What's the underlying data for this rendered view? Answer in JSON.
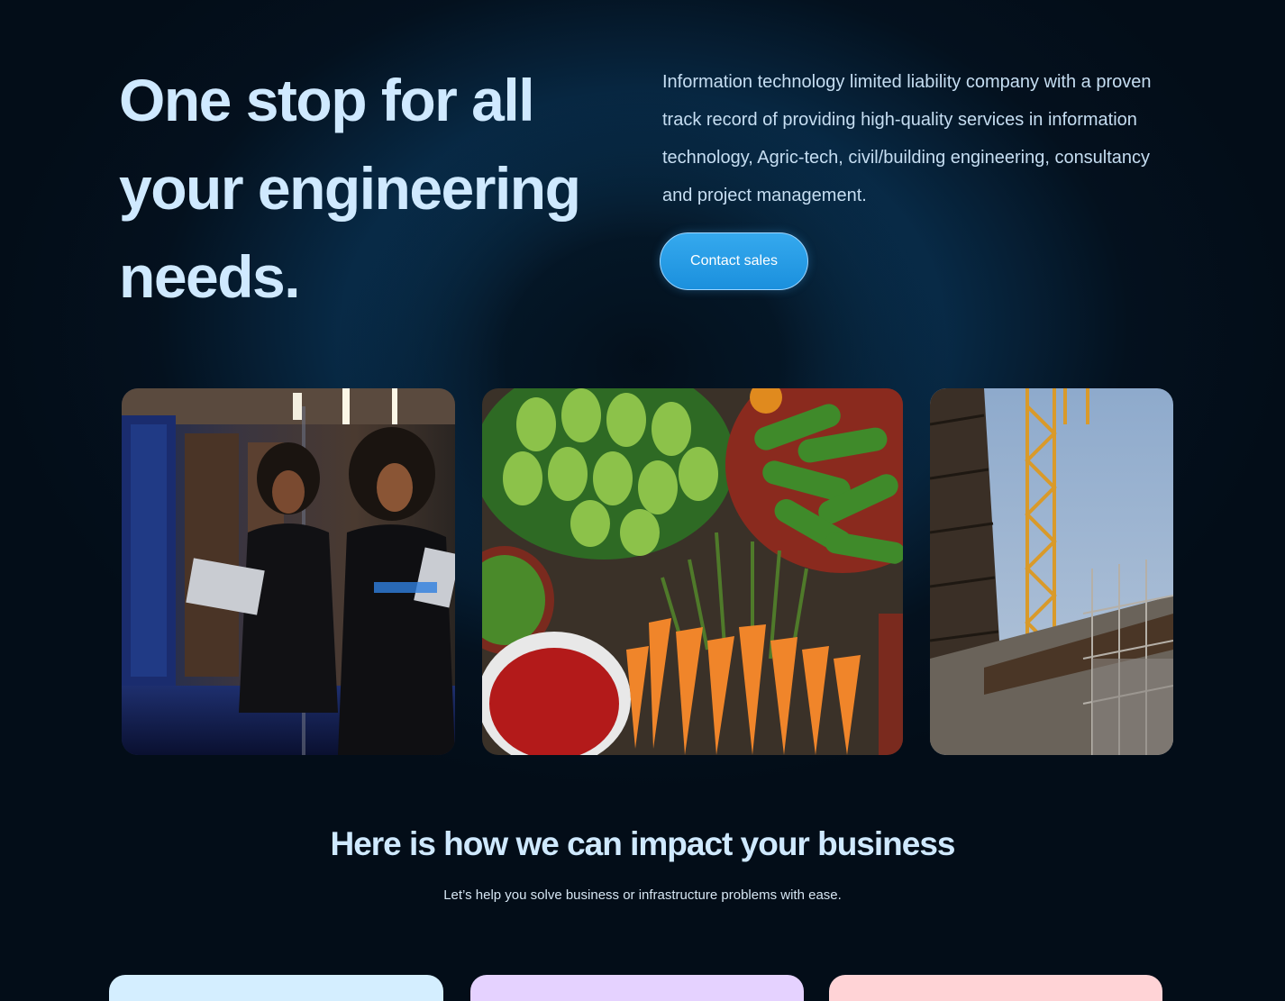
{
  "hero": {
    "title": "One stop for all your engineering needs.",
    "description": "Information technology limited liability company with a proven track record of providing high-quality services in information technology, Agric-tech, civil/building engineering, consultancy and project management.",
    "cta_label": "Contact sales"
  },
  "colors": {
    "background": "#030d18",
    "heading": "#cfe9ff",
    "accent": "#2a9fe8",
    "card_1": "#d4eeff",
    "card_2": "#e5d2ff",
    "card_3": "#ffd3d6"
  },
  "gallery": [
    {
      "subject": "woman with laptop in server room"
    },
    {
      "subject": "market vegetables: bitter gourds, cucumbers, carrots, chilies"
    },
    {
      "subject": "construction site with crane and scaffolding"
    }
  ],
  "impact": {
    "title": "Here is how we can impact your business",
    "subtitle": "Let’s help you solve business or infrastructure problems with ease."
  }
}
